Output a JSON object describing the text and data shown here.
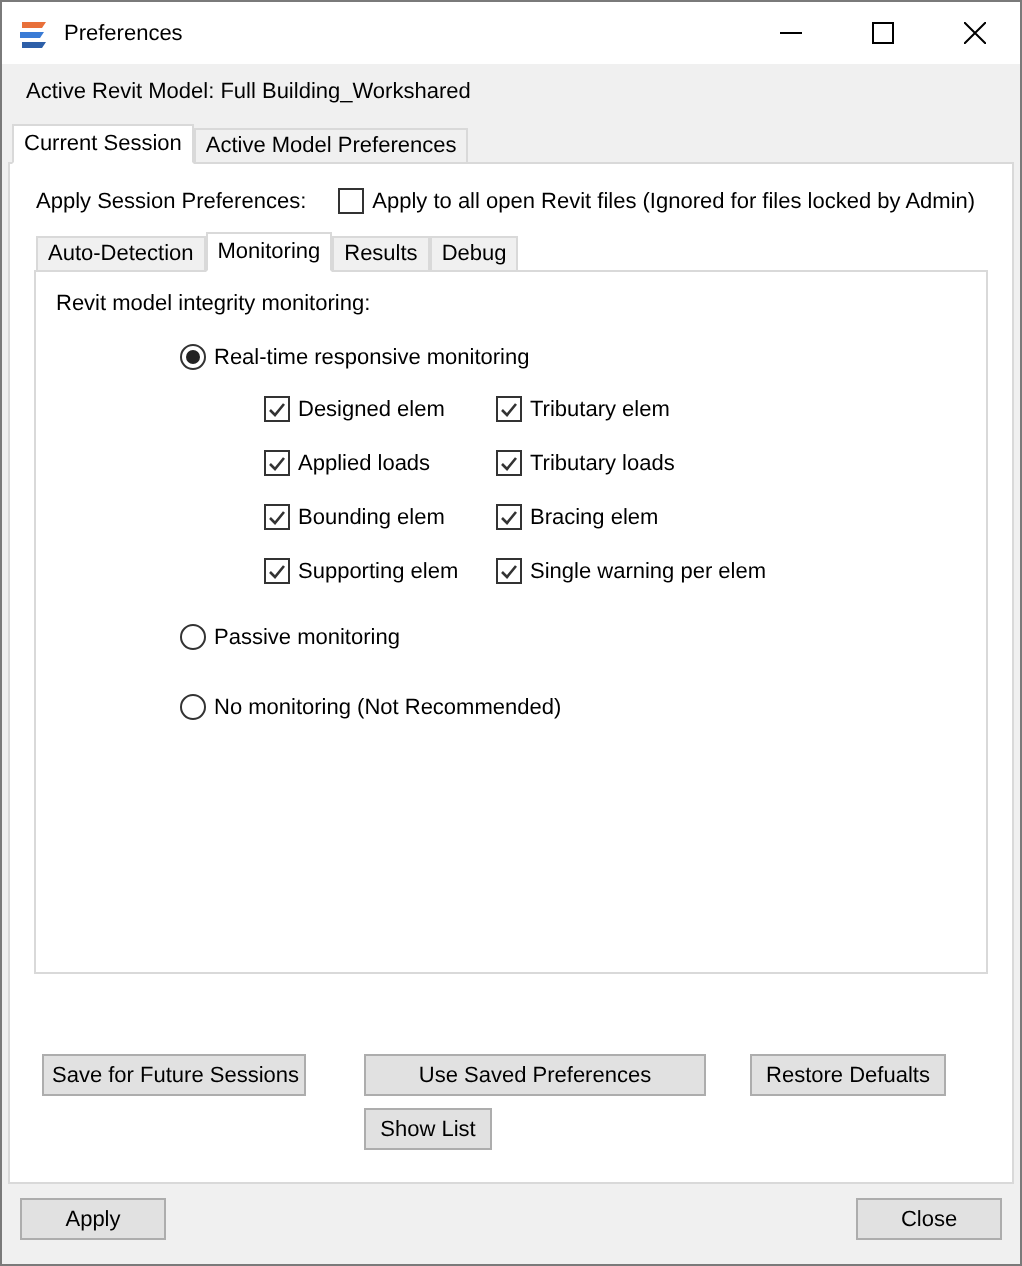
{
  "window": {
    "title": "Preferences"
  },
  "active_model": "Active Revit Model:  Full Building_Workshared",
  "tabs": [
    {
      "label": "Current Session",
      "selected": true
    },
    {
      "label": "Active Model Preferences",
      "selected": false
    }
  ],
  "session": {
    "label": "Apply Session Preferences:",
    "checkbox": {
      "label": "Apply to all open Revit files (Ignored for files locked by Admin)",
      "checked": false
    }
  },
  "subtabs": [
    {
      "label": "Auto-Detection",
      "selected": false
    },
    {
      "label": "Monitoring",
      "selected": true
    },
    {
      "label": "Results",
      "selected": false
    },
    {
      "label": "Debug",
      "selected": false
    }
  ],
  "monitoring": {
    "heading": "Revit model integrity monitoring:",
    "options": [
      {
        "label": "Real-time responsive monitoring",
        "selected": true,
        "checks": [
          {
            "label": "Designed elem",
            "checked": true
          },
          {
            "label": "Tributary elem",
            "checked": true
          },
          {
            "label": "Applied loads",
            "checked": true
          },
          {
            "label": "Tributary loads",
            "checked": true
          },
          {
            "label": "Bounding elem",
            "checked": true
          },
          {
            "label": "Bracing elem",
            "checked": true
          },
          {
            "label": "Supporting elem",
            "checked": true
          },
          {
            "label": "Single warning per elem",
            "checked": true
          }
        ]
      },
      {
        "label": "Passive monitoring",
        "selected": false
      },
      {
        "label": "No monitoring (Not Recommended)",
        "selected": false
      }
    ]
  },
  "panel_buttons": [
    "Save for Future Sessions",
    "Use Saved Preferences",
    "Restore Defualts"
  ],
  "show_list": "Show List",
  "footer": {
    "apply": "Apply",
    "close": "Close"
  }
}
